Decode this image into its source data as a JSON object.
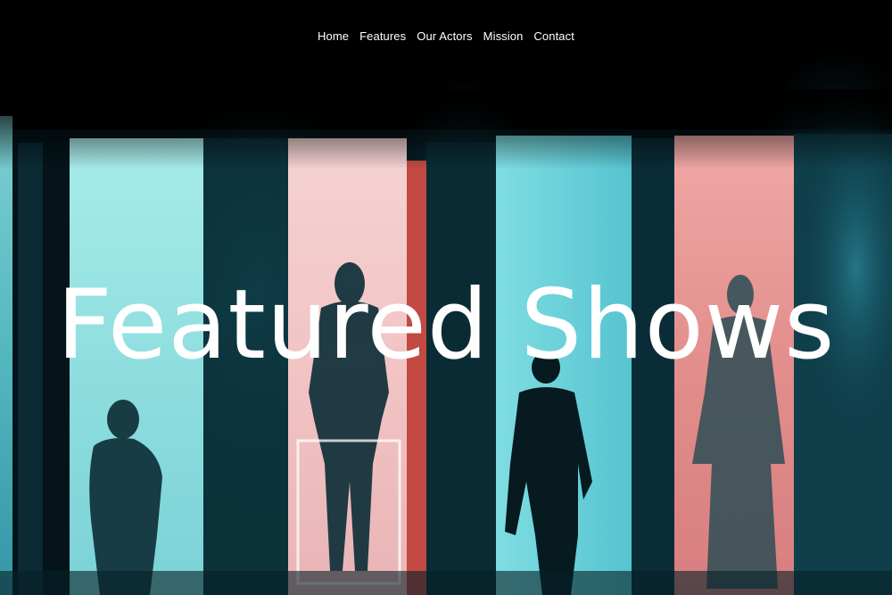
{
  "nav": {
    "items": [
      {
        "label": "Home"
      },
      {
        "label": "Features"
      },
      {
        "label": "Our Actors"
      },
      {
        "label": "Mission"
      },
      {
        "label": "Contact"
      }
    ]
  },
  "hero": {
    "title": "Featured Shows"
  },
  "colors": {
    "background": "#000000",
    "teal_panel": "#5fd0d8",
    "pink_panel": "#e89a9a",
    "text": "#ffffff"
  }
}
